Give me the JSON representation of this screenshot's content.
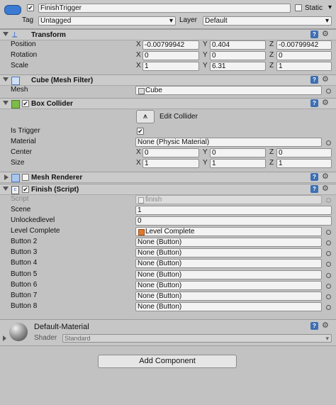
{
  "gameobject": {
    "name": "FinishTrigger",
    "static_label": "Static",
    "tag_label": "Tag",
    "tag_value": "Untagged",
    "layer_label": "Layer",
    "layer_value": "Default"
  },
  "transform": {
    "title": "Transform",
    "position_label": "Position",
    "rotation_label": "Rotation",
    "scale_label": "Scale",
    "position": {
      "x": "-0.00799942",
      "y": "0.404",
      "z": "-0.00799942"
    },
    "rotation": {
      "x": "0",
      "y": "0",
      "z": "0"
    },
    "scale": {
      "x": "1",
      "y": "6.31",
      "z": "1"
    }
  },
  "axes": {
    "x": "X",
    "y": "Y",
    "z": "Z"
  },
  "mesh_filter": {
    "title": "Cube (Mesh Filter)",
    "mesh_label": "Mesh",
    "mesh_value": "Cube"
  },
  "box_collider": {
    "title": "Box Collider",
    "edit_label": "Edit Collider",
    "is_trigger_label": "Is Trigger",
    "material_label": "Material",
    "material_value": "None (Physic Material)",
    "center_label": "Center",
    "size_label": "Size",
    "center": {
      "x": "0",
      "y": "0",
      "z": "0"
    },
    "size": {
      "x": "1",
      "y": "1",
      "z": "1"
    }
  },
  "mesh_renderer": {
    "title": "Mesh Renderer"
  },
  "finish_script": {
    "title": "Finish (Script)",
    "script_label": "Script",
    "script_value": "finish",
    "scene_label": "Scene",
    "scene_value": "1",
    "unlocked_label": "Unlockedlevel",
    "unlocked_value": "0",
    "level_complete_label": "Level Complete",
    "level_complete_value": "Level Complete",
    "buttons": [
      {
        "label": "Button 2",
        "value": "None (Button)"
      },
      {
        "label": "Button 3",
        "value": "None (Button)"
      },
      {
        "label": "Button 4",
        "value": "None (Button)"
      },
      {
        "label": "Button 5",
        "value": "None (Button)"
      },
      {
        "label": "Button 6",
        "value": "None (Button)"
      },
      {
        "label": "Button 7",
        "value": "None (Button)"
      },
      {
        "label": "Button 8",
        "value": "None (Button)"
      }
    ]
  },
  "material": {
    "name": "Default-Material",
    "shader_label": "Shader",
    "shader_value": "Standard"
  },
  "add_component_label": "Add Component",
  "icons": {
    "help": "?",
    "gear": "⚙",
    "checkmark": "✔",
    "dropdown": "▾"
  }
}
